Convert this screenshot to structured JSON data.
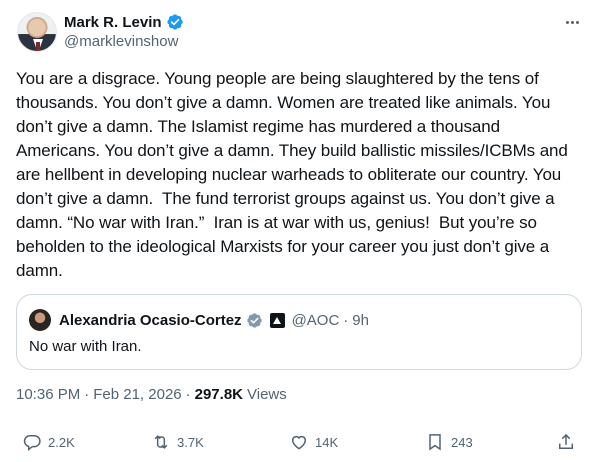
{
  "author": {
    "display_name": "Mark R. Levin",
    "handle": "@marklevinshow",
    "avatar_icon": "profile-photo",
    "verified_color": "#1d9bf0"
  },
  "tweet": {
    "text": "You are a disgrace. Young people are being slaughtered by the tens of thousands. You don’t give a damn. Women are treated like animals. You don’t give a damn. The Islamist regime has murdered a thousand Americans. You don’t give a damn. They build ballistic missiles/ICBMs and are hellbent in developing nuclear warheads to obliterate our country. You don’t give a damn.  The fund terrorist groups against us. You don’t give a damn. “No war with Iran.”  Iran is at war with us, genius!  But you’re so beholden to the ideological Marxists for your career you just don’t give a damn."
  },
  "quoted": {
    "display_name": "Alexandria Ocasio-Cortez",
    "handle": "@AOC",
    "separator": "·",
    "time": "9h",
    "text": "No war with Iran.",
    "verified_color": "#829aab"
  },
  "meta": {
    "time": "10:36 PM",
    "separator1": "·",
    "date": "Feb 21, 2026",
    "separator2": "·",
    "views_count": "297.8K",
    "views_label": "Views"
  },
  "actions": {
    "reply_count": "2.2K",
    "repost_count": "3.7K",
    "like_count": "14K",
    "bookmark_count": "243"
  },
  "colors": {
    "text": "#0f1419",
    "secondary": "#536471",
    "border": "#cfd9de",
    "accent": "#1d9bf0"
  }
}
